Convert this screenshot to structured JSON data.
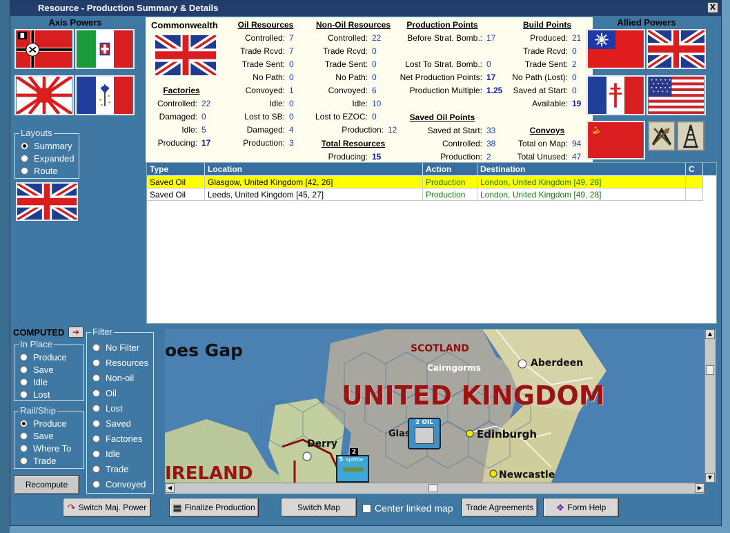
{
  "window": {
    "title": "Resource - Production Summary & Details",
    "close": "X"
  },
  "axis": {
    "title": "Axis Powers",
    "flags": [
      "germany-flag",
      "italy-flag",
      "japan-flag",
      "vichy-france-flag"
    ]
  },
  "allied": {
    "title": "Allied Powers",
    "flags": [
      "china-flag",
      "uk-flag",
      "free-france-flag",
      "usa-flag",
      "ussr-flag",
      "minor-resources-flag",
      "oil-derrick-flag"
    ]
  },
  "layouts": {
    "label": "Layouts",
    "options": [
      "Summary",
      "Expanded",
      "Route"
    ],
    "selected": "Summary"
  },
  "summary": {
    "power": "Commonwealth",
    "factories": {
      "title": "Factories",
      "rows": [
        {
          "label": "Controlled:",
          "value": "22"
        },
        {
          "label": "Damaged:",
          "value": "0"
        },
        {
          "label": "Idle:",
          "value": "5"
        },
        {
          "label": "Producing:",
          "value": "17"
        }
      ]
    },
    "oil": {
      "title": "Oil Resources",
      "rows": [
        {
          "label": "Controlled:",
          "value": "7"
        },
        {
          "label": "Trade Rcvd:",
          "value": "7"
        },
        {
          "label": "Trade Sent:",
          "value": "0"
        },
        {
          "label": "No Path:",
          "value": "0"
        },
        {
          "label": "Convoyed:",
          "value": "1"
        },
        {
          "label": "Idle:",
          "value": "0"
        },
        {
          "label": "Lost to SB:",
          "value": "0"
        },
        {
          "label": "Damaged:",
          "value": "4"
        },
        {
          "label": "Production:",
          "value": "3"
        }
      ]
    },
    "nonoil": {
      "title": "Non-Oil Resources",
      "rows": [
        {
          "label": "Controlled:",
          "value": "22"
        },
        {
          "label": "Trade Rcvd:",
          "value": "0"
        },
        {
          "label": "Trade Sent:",
          "value": "0"
        },
        {
          "label": "No Path:",
          "value": "0"
        },
        {
          "label": "Convoyed:",
          "value": "6"
        },
        {
          "label": "Idle:",
          "value": "10"
        },
        {
          "label": "Lost to EZOC:",
          "value": "0"
        },
        {
          "label": "Production:",
          "value": "12"
        }
      ]
    },
    "total": {
      "title": "Total Resources",
      "label": "Producing:",
      "value": "15"
    },
    "pp": {
      "title": "Production Points",
      "rows": [
        {
          "label": "Before Strat. Bomb.:",
          "value": "17"
        },
        {
          "label": "Lost To Strat. Bomb.:",
          "value": "0"
        },
        {
          "label": "Net Production Points:",
          "value": "17"
        },
        {
          "label": "Production Multiple:",
          "value": "1.25"
        }
      ]
    },
    "savedoil": {
      "title": "Saved Oil Points",
      "rows": [
        {
          "label": "Saved at Start:",
          "value": "33"
        },
        {
          "label": "Controlled:",
          "value": "38"
        },
        {
          "label": "Production:",
          "value": "2"
        }
      ]
    },
    "bp": {
      "title": "Build Points",
      "rows": [
        {
          "label": "Produced:",
          "value": "21"
        },
        {
          "label": "Trade Rcvd:",
          "value": "0"
        },
        {
          "label": "Trade Sent:",
          "value": "2"
        },
        {
          "label": "No Path (Lost):",
          "value": "0"
        },
        {
          "label": "Saved at Start:",
          "value": "0"
        },
        {
          "label": "Available:",
          "value": "19"
        }
      ]
    },
    "convoys": {
      "title": "Convoys",
      "rows": [
        {
          "label": "Total on Map:",
          "value": "94"
        },
        {
          "label": "Total Unused:",
          "value": "47"
        }
      ]
    }
  },
  "table": {
    "headers": [
      "Type",
      "Location",
      "Action",
      "Destination",
      "C"
    ],
    "rows": [
      {
        "type": "Saved Oil",
        "location": "Glasgow, United Kingdom [42, 26]",
        "action": "Production",
        "destination": "London, United Kingdom [49, 28]",
        "c": ""
      },
      {
        "type": "Saved Oil",
        "location": "Leeds, United Kingdom [45, 27]",
        "action": "Production",
        "destination": "London, United Kingdom [49, 28]",
        "c": ""
      }
    ]
  },
  "filters": {
    "computed": "COMPUTED",
    "inplace": {
      "label": "In Place",
      "options": [
        "Produce",
        "Save",
        "Idle",
        "Lost"
      ]
    },
    "railship": {
      "label": "Rail/Ship",
      "options": [
        "Produce",
        "Save",
        "Where To",
        "Trade"
      ],
      "selected": "Produce"
    },
    "filter": {
      "label": "Filter",
      "options": [
        "No Filter",
        "Resources",
        "Non-oil",
        "Oil",
        "Lost",
        "Saved",
        "Factories",
        "Idle",
        "Trade",
        "Convoyed"
      ]
    },
    "recompute": "Recompute"
  },
  "map": {
    "labels": {
      "faroes": "oes Gap",
      "scotland": "SCOTLAND",
      "cairngorms": "Cairngorms",
      "aberdeen": "Aberdeen",
      "uk": "UNITED KINGDOM",
      "edinburgh": "Edinburgh",
      "glasgow": "Glas",
      "derry": "Derry",
      "ireland": "IRELAND",
      "newcastle": "Newcastle",
      "oil_counter": "2 OIL",
      "unit_number": "2",
      "unit_strength": "5",
      "unit_name": "Spitfire"
    }
  },
  "buttons": {
    "switch_power": "Switch Maj. Power",
    "finalize": "Finalize Production",
    "switch_map": "Switch Map",
    "center_linked": "Center linked map",
    "trade": "Trade Agreements",
    "help": "Form Help"
  }
}
